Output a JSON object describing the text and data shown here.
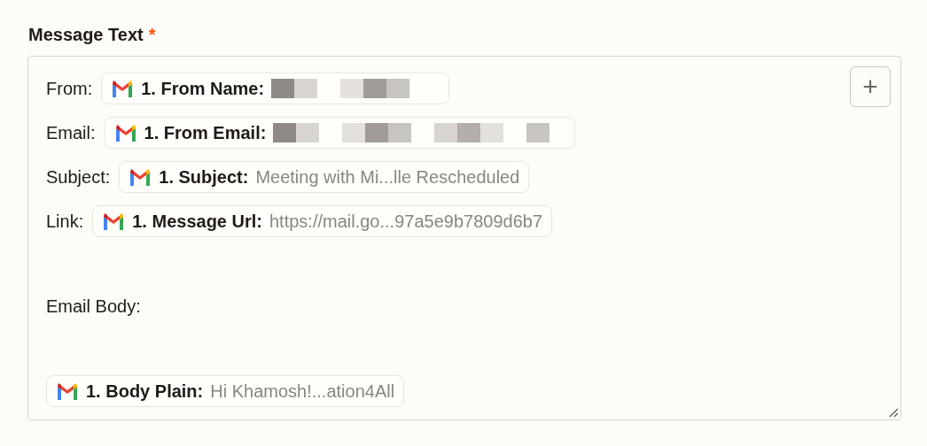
{
  "field": {
    "label": "Message Text",
    "required_mark": "*"
  },
  "add_button": {
    "label": "+"
  },
  "lines": [
    {
      "kind": "token",
      "label": "From:",
      "token": {
        "source": "1. From Name:",
        "redacted": true
      }
    },
    {
      "kind": "token",
      "label": "Email:",
      "token": {
        "source": "1. From Email:",
        "redacted": true
      }
    },
    {
      "kind": "token",
      "label": "Subject:",
      "token": {
        "source": "1. Subject:",
        "redacted": false,
        "value": "Meeting with Mi...lle Rescheduled"
      }
    },
    {
      "kind": "token",
      "label": "Link:",
      "token": {
        "source": "1. Message Url:",
        "redacted": false,
        "value": "https://mail.go...97a5e9b7809d6b7"
      }
    },
    {
      "kind": "blank"
    },
    {
      "kind": "text",
      "label": "Email Body:"
    },
    {
      "kind": "blank"
    },
    {
      "kind": "token",
      "token": {
        "source": "1. Body Plain:",
        "redacted": false,
        "value": "Hi Khamosh!...ation4All"
      }
    }
  ]
}
